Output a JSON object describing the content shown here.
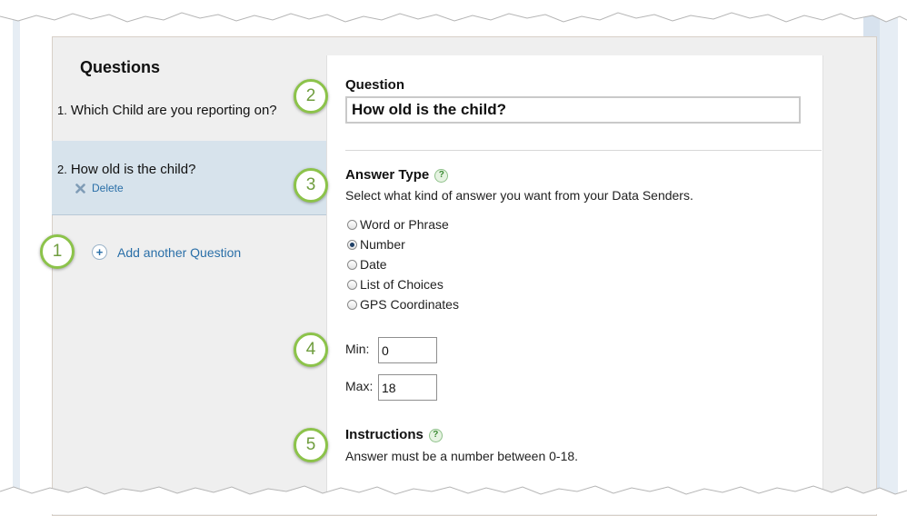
{
  "sidebar": {
    "title": "Questions",
    "questions": [
      {
        "number": "1.",
        "text": "Which Child are you reporting on?"
      },
      {
        "number": "2.",
        "text": "How old is the child?"
      }
    ],
    "delete_label": "Delete",
    "add_label": "Add another Question"
  },
  "editor": {
    "question_label": "Question",
    "question_value": "How old is the child?",
    "answer_type_label": "Answer Type",
    "answer_type_desc": "Select what kind of answer you want from your Data Senders.",
    "answer_types": [
      "Word or Phrase",
      "Number",
      "Date",
      "List of Choices",
      "GPS Coordinates"
    ],
    "selected_answer_type": "Number",
    "min_label": "Min:",
    "min_value": "0",
    "max_label": "Max:",
    "max_value": "18",
    "instructions_label": "Instructions",
    "instructions_text": "Answer must be a number between 0-18."
  },
  "badges": [
    "1",
    "2",
    "3",
    "4",
    "5"
  ],
  "colors": {
    "badge_border": "#8cc34a",
    "link": "#2a6fa8",
    "selected_row": "#d7e3ec",
    "help_icon": "#3b8a33"
  }
}
